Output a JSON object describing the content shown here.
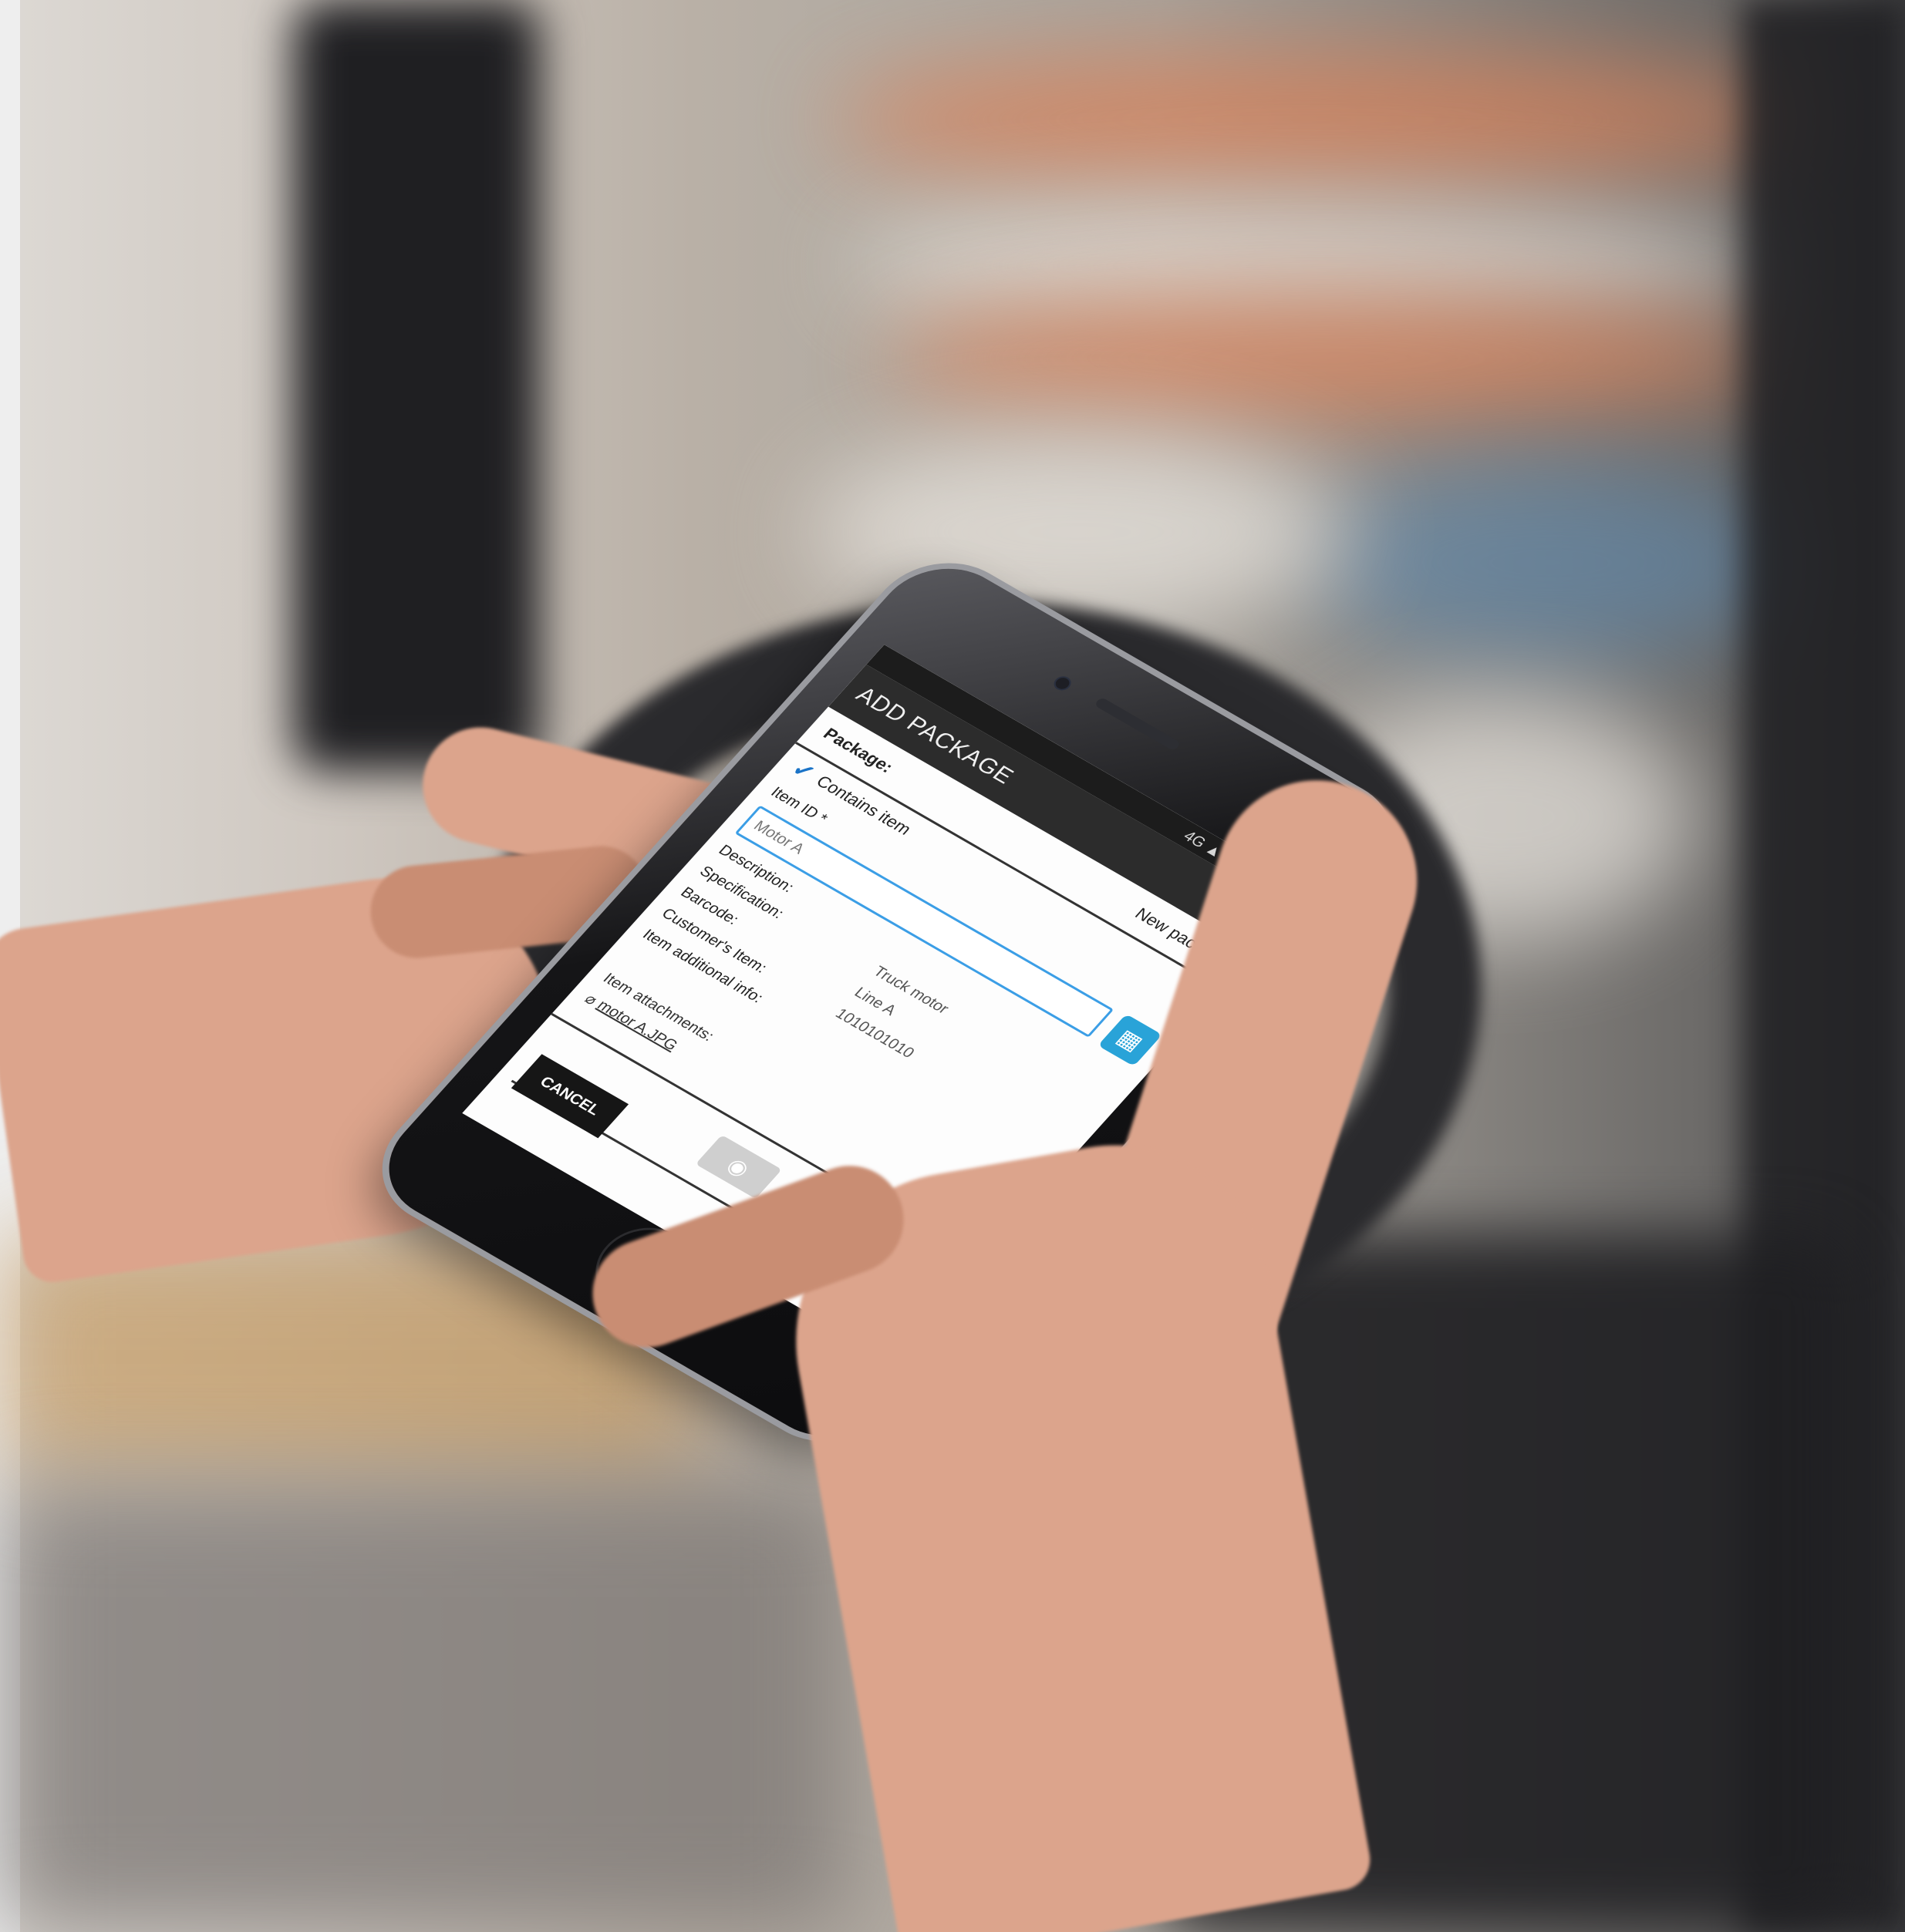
{
  "statusbar": {
    "text": "4G ▲ 90% ▮ 8:17"
  },
  "appbar": {
    "title": "ADD PACKAGE"
  },
  "form": {
    "package_label": "Package:",
    "package_value": "New package",
    "contains_item_label": "Contains item",
    "item_id_label": "Item ID *",
    "item_id_value": "Motor A",
    "details": [
      {
        "key": "Description:",
        "value": ""
      },
      {
        "key": "Specification:",
        "value": "Truck motor"
      },
      {
        "key": "Barcode:",
        "value": "Line A"
      },
      {
        "key": "Customer's Item:",
        "value": "1010101010"
      },
      {
        "key": "Item additional info:",
        "value": ""
      }
    ],
    "attachments_label": "Item attachments:",
    "attachment_file": "motor A.JPG"
  },
  "buttons": {
    "cancel": "CANCEL",
    "go": "▸"
  }
}
